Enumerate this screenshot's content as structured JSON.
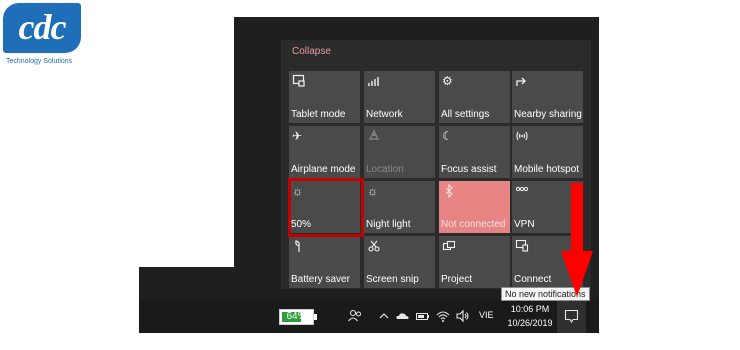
{
  "logo": {
    "text": "cdc",
    "tagline": "Technology Solutions",
    "color": "#1f6fb8"
  },
  "action_center": {
    "collapse_label": "Collapse",
    "tiles": [
      {
        "label": "Tablet mode",
        "icon": "tablet-mode-icon",
        "state": "off"
      },
      {
        "label": "Network",
        "icon": "network-icon",
        "state": "off"
      },
      {
        "label": "All settings",
        "icon": "gear-icon",
        "state": "off"
      },
      {
        "label": "Nearby sharing",
        "icon": "share-icon",
        "state": "off"
      },
      {
        "label": "Airplane mode",
        "icon": "airplane-icon",
        "state": "off"
      },
      {
        "label": "Location",
        "icon": "location-icon",
        "state": "disabled"
      },
      {
        "label": "Focus assist",
        "icon": "moon-icon",
        "state": "off"
      },
      {
        "label": "Mobile hotspot",
        "icon": "hotspot-icon",
        "state": "off"
      },
      {
        "label": "50%",
        "icon": "brightness-icon",
        "state": "off"
      },
      {
        "label": "Night light",
        "icon": "night-light-icon",
        "state": "off"
      },
      {
        "label": "Not connected",
        "icon": "bluetooth-icon",
        "state": "active"
      },
      {
        "label": "VPN",
        "icon": "vpn-icon",
        "state": "off"
      },
      {
        "label": "Battery saver",
        "icon": "battery-saver-icon",
        "state": "off"
      },
      {
        "label": "Screen snip",
        "icon": "screen-snip-icon",
        "state": "off"
      },
      {
        "label": "Project",
        "icon": "project-icon",
        "state": "off"
      },
      {
        "label": "Connect",
        "icon": "connect-icon",
        "state": "off"
      }
    ],
    "highlighted_tile": "50%",
    "highlight_color": "#c40000",
    "active_tile_color": "#e78585"
  },
  "taskbar": {
    "battery_percent": "64%",
    "battery_level": 0.64,
    "language": "VIE",
    "time": "10:06 PM",
    "date": "10/26/2019",
    "notification_tooltip": "No new notifications"
  },
  "annotation": {
    "arrow_color": "#ff0000",
    "points_to": "action-center-button"
  }
}
